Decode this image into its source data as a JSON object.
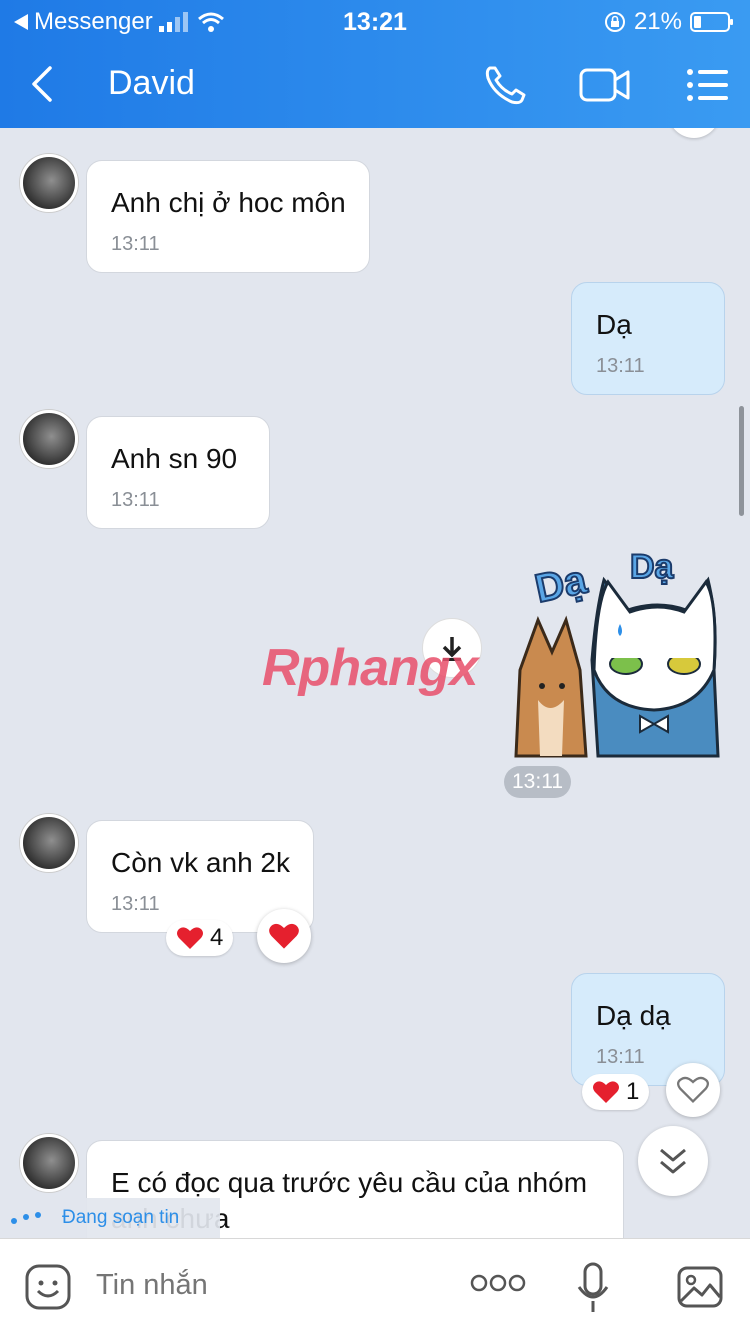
{
  "status_bar": {
    "back_app": "Messenger",
    "time": "13:21",
    "battery": "21%"
  },
  "header": {
    "contact_name": "David"
  },
  "messages": [
    {
      "text": "Anh chị ở hoc môn",
      "time": "13:11"
    },
    {
      "text": "Dạ",
      "time": "13:11"
    },
    {
      "text": "Anh sn 90",
      "time": "13:11"
    },
    {
      "sticker_texts": [
        "Dạ",
        "Dạ"
      ],
      "time": "13:11"
    },
    {
      "text": "Còn vk anh 2k",
      "time": "13:11",
      "reaction_count": "4"
    },
    {
      "text": "Dạ dạ",
      "time": "13:11",
      "reaction_count": "1"
    },
    {
      "text": "E có đọc qua trước yêu cầu của nhóm",
      "text2": "anh chưa"
    }
  ],
  "watermark": "Rphangx",
  "typing_indicator": "Đang soạn tin",
  "composer": {
    "placeholder": "Tin nhắn"
  },
  "colors": {
    "header_start": "#1f7ae6",
    "header_end": "#3a9bf2",
    "outgoing_bubble": "#d6ebfb",
    "chat_bg": "#e2e6ee",
    "heart": "#e5202e"
  }
}
